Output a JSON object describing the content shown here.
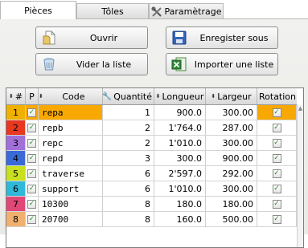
{
  "tabs": [
    {
      "label": "Pièces",
      "active": true
    },
    {
      "label": "Tôles",
      "active": false
    },
    {
      "label": "Paramètrage",
      "active": false,
      "icon": "tools-icon"
    }
  ],
  "buttons": {
    "open": "Ouvrir",
    "save_as": "Enregister sous",
    "clear": "Vider la liste",
    "import": "Importer une liste"
  },
  "table": {
    "headers": {
      "index": "#",
      "p": "P",
      "code": "Code",
      "quantity": "Quantité",
      "length": "Longueur",
      "width": "Largeur",
      "rotation": "Rotation"
    },
    "rows": [
      {
        "index": "1",
        "color": "#f0b000",
        "checked": true,
        "code": "repa",
        "quantity": "1",
        "length": "900.0",
        "width": "300.00",
        "rotation": true,
        "selected": true
      },
      {
        "index": "2",
        "color": "#e83820",
        "checked": true,
        "code": "repb",
        "quantity": "2",
        "length": "1'764.0",
        "width": "287.00",
        "rotation": true,
        "selected": false
      },
      {
        "index": "3",
        "color": "#a070d8",
        "checked": true,
        "code": "repc",
        "quantity": "2",
        "length": "1'010.0",
        "width": "300.00",
        "rotation": true,
        "selected": false
      },
      {
        "index": "4",
        "color": "#3a6ad8",
        "checked": true,
        "code": "repd",
        "quantity": "3",
        "length": "300.0",
        "width": "900.00",
        "rotation": true,
        "selected": false
      },
      {
        "index": "5",
        "color": "#c8e020",
        "checked": true,
        "code": "traverse",
        "quantity": "6",
        "length": "2'597.0",
        "width": "292.00",
        "rotation": true,
        "selected": false
      },
      {
        "index": "6",
        "color": "#30b8d8",
        "checked": true,
        "code": "support",
        "quantity": "6",
        "length": "1'010.0",
        "width": "300.00",
        "rotation": true,
        "selected": false
      },
      {
        "index": "7",
        "color": "#e04878",
        "checked": true,
        "code": "10300",
        "quantity": "8",
        "length": "180.0",
        "width": "180.00",
        "rotation": true,
        "selected": false
      },
      {
        "index": "8",
        "color": "#f0b070",
        "checked": true,
        "code": "20700",
        "quantity": "8",
        "length": "160.0",
        "width": "500.00",
        "rotation": true,
        "selected": false
      }
    ]
  }
}
